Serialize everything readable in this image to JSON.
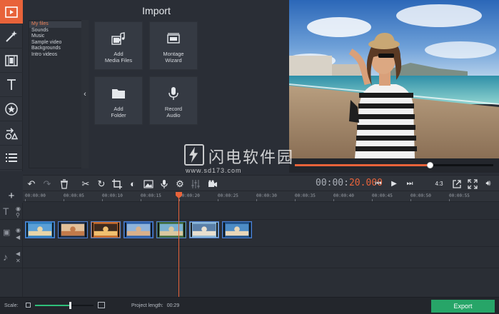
{
  "rail": {
    "items": [
      {
        "icon": "import-media-icon",
        "active": true
      },
      {
        "icon": "magic-wand-icon",
        "active": false
      },
      {
        "icon": "film-filters-icon",
        "active": false
      },
      {
        "icon": "titles-text-icon",
        "active": false
      },
      {
        "icon": "stickers-star-icon",
        "active": false
      },
      {
        "icon": "shapes-callouts-icon",
        "active": false
      },
      {
        "icon": "list-menu-icon",
        "active": false
      }
    ]
  },
  "import": {
    "title": "Import",
    "folders": [
      "My files",
      "Sounds",
      "Music",
      "Sample video",
      "Backgrounds",
      "Intro videos"
    ],
    "selected_folder": "My files",
    "tiles": [
      {
        "label": "Add\nMedia Files",
        "icon": "add-media-icon"
      },
      {
        "label": "Montage\nWizard",
        "icon": "montage-wizard-icon"
      },
      {
        "label": "Add\nFolder",
        "icon": "add-folder-icon"
      },
      {
        "label": "Record\nAudio",
        "icon": "microphone-icon"
      }
    ]
  },
  "player": {
    "progress": 0.68,
    "timecode_dim": "00:00:",
    "timecode_active": "20.000",
    "aspect_label": "4:3"
  },
  "watermark": {
    "text": "闪电软件园",
    "url": "www.sd173.com"
  },
  "ruler": {
    "ticks": [
      "00:00:00",
      "00:00:05",
      "00:00:10",
      "00:00:15",
      "00:00:20",
      "00:00:25",
      "00:00:30",
      "00:00:35",
      "00:00:40",
      "00:00:45",
      "00:00:50",
      "00:00:55"
    ]
  },
  "timeline": {
    "clip_count": 7
  },
  "status": {
    "scale_label": "Scale:",
    "scale_value": 0.6,
    "project_length_label": "Project length:",
    "project_length": "00:29",
    "export_label": "Export"
  },
  "colors": {
    "accent": "#e8633a",
    "export": "#27a568",
    "clip_border": "#4f7fd0"
  }
}
